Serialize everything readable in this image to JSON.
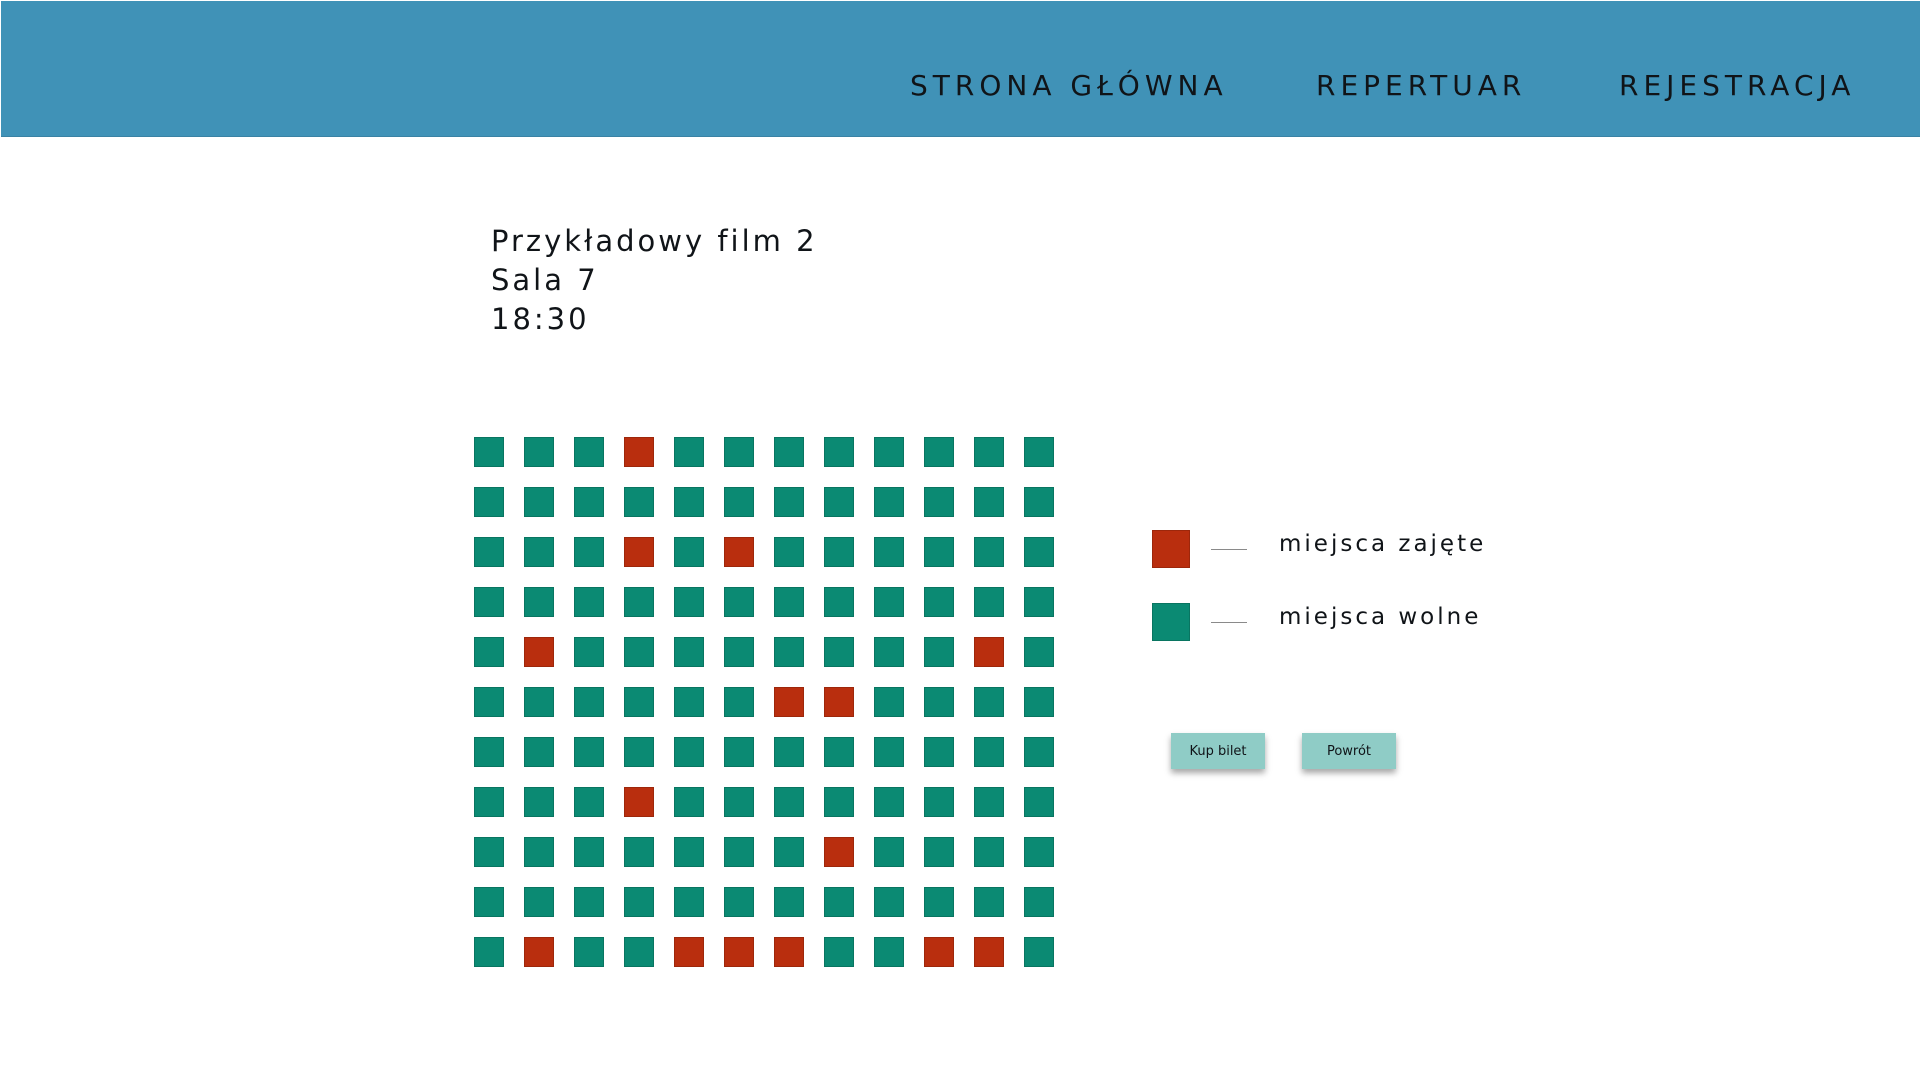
{
  "nav": {
    "home": "STRONA GŁÓWNA",
    "repertoire": "REPERTUAR",
    "registration": "REJESTRACJA"
  },
  "movie": {
    "title": "Przykładowy film 2",
    "hall": "Sala 7",
    "time": "18:30"
  },
  "colors": {
    "header": "#4092b7",
    "occupied": "#b92e0e",
    "free": "#0b8a73",
    "button": "#8fccc6"
  },
  "seats": {
    "rows": [
      "FFFOFFFFFFFF",
      "FFFFFFFFFFFF",
      "FFFOFOFFFFFF",
      "FFFFFFFFFFFF",
      "FOFFFFFFFFOF",
      "FFFFFFOOFFFF",
      "FFFFFFFFFFFF",
      "FFFOFFFFFFFF",
      "FFFFFFFOFFFF",
      "FFFFFFFFFFFF",
      "FOFFOOOFFOOF"
    ]
  },
  "legend": {
    "occupied_label": "miejsca zajęte",
    "free_label": "miejsca wolne"
  },
  "buttons": {
    "buy": "Kup bilet",
    "back": "Powrót"
  }
}
